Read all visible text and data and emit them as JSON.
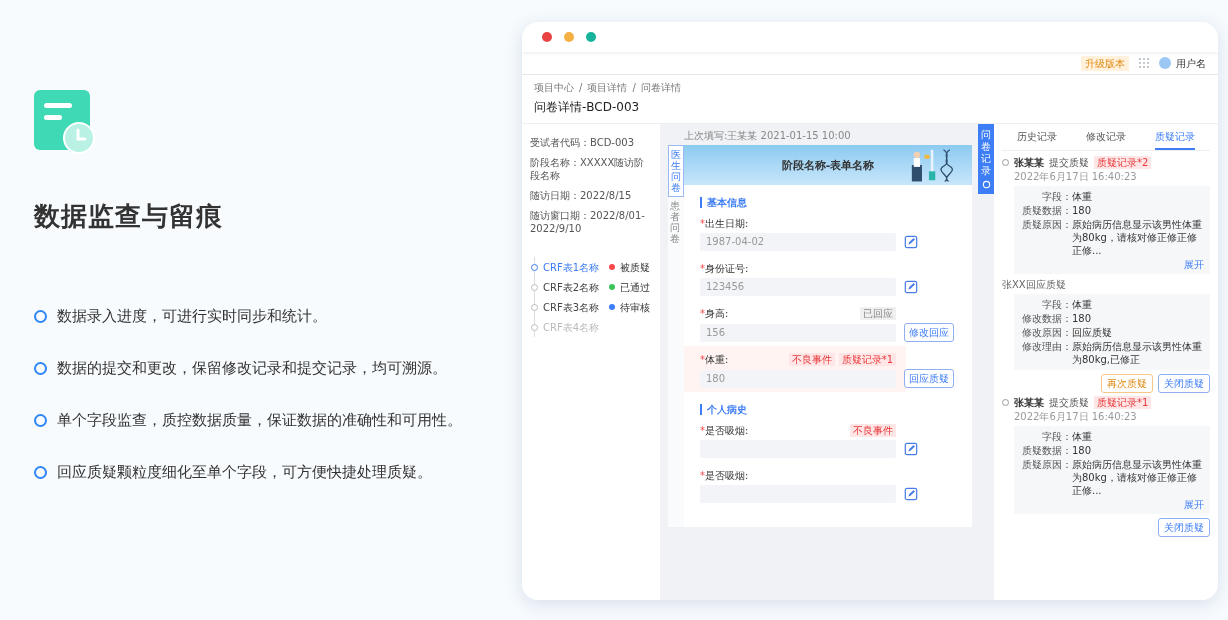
{
  "hero": {
    "title": "数据监查与留痕",
    "features": [
      "数据录入进度，可进行实时同步和统计。",
      "数据的提交和更改，保留修改记录和提交记录，均可溯源。",
      "单个字段监查，质控数据质量，保证数据的准确性和可用性。",
      "回应质疑颗粒度细化至单个字段，可方便快捷处理质疑。"
    ]
  },
  "app": {
    "topbar": {
      "badge": "升级版本",
      "user": "用户名"
    },
    "breadcrumb": {
      "items": [
        "项目中心",
        "项目详情",
        "问卷详情"
      ],
      "separator": "/"
    },
    "page_title": "问卷详情-BCD-003",
    "info": [
      "受试者代码：BCD-003",
      "阶段名称：XXXXX随访阶段名称",
      "随访日期：2022/8/15",
      "随访窗口期：2022/8/01-2022/9/10"
    ],
    "crf_forms": [
      {
        "name": "CRF表1名称",
        "selected": true,
        "disabled": false,
        "status": "被质疑",
        "color": "#f5484a"
      },
      {
        "name": "CRF表2名称",
        "selected": false,
        "disabled": false,
        "status": "已通过",
        "color": "#3cc45a"
      },
      {
        "name": "CRF表3名称",
        "selected": false,
        "disabled": false,
        "status": "待审核",
        "color": "#3d7df5"
      },
      {
        "name": "CRF表4名称",
        "selected": false,
        "disabled": true
      }
    ],
    "form": {
      "last_edit": "上次填写:王某某 2021-01-15 10:00",
      "side_tabs": [
        {
          "label": "医生问卷",
          "selected": true
        },
        {
          "label": "患者问卷",
          "selected": false
        }
      ],
      "banner_title": "阶段名称-表单名称",
      "sections": [
        {
          "title": "基本信息",
          "fields": [
            {
              "required_mark": "*",
              "label": "出生日期:",
              "value": "1987-04-02",
              "flagged": false,
              "action": {
                "kind": "edit"
              }
            },
            {
              "required_mark": "*",
              "label": "身份证号:",
              "value": "123456",
              "flagged": false,
              "action": {
                "kind": "edit"
              }
            },
            {
              "required_mark": "*",
              "label": "身高:",
              "value": "156",
              "flagged": false,
              "tags": [
                {
                  "text": "已回应",
                  "kind": "neutral"
                }
              ],
              "action": {
                "kind": "button",
                "label": "修改回应"
              }
            },
            {
              "required_mark": "*",
              "label": "体重:",
              "value": "180",
              "flagged": true,
              "tags": [
                {
                  "text": "不良事件",
                  "kind": "danger"
                },
                {
                  "text": "质疑记录*1",
                  "kind": "danger"
                }
              ],
              "action": {
                "kind": "button",
                "label": "回应质疑"
              }
            }
          ]
        },
        {
          "title": "个人病史",
          "fields": [
            {
              "required_mark": "*",
              "label": "是否吸烟:",
              "flagged": false,
              "tags": [
                {
                  "text": "不良事件",
                  "kind": "danger"
                }
              ],
              "action": {
                "kind": "edit"
              }
            },
            {
              "required_mark": "*",
              "label": "是否吸烟:",
              "flagged": false,
              "action": {
                "kind": "edit"
              }
            }
          ]
        }
      ]
    },
    "record_tab": "问卷记录",
    "records": {
      "tabs": [
        {
          "label": "历史记录",
          "selected": false
        },
        {
          "label": "修改记录",
          "selected": false
        },
        {
          "label": "质疑记录",
          "selected": true
        }
      ],
      "entries": [
        {
          "kind": "query",
          "user": "张某某",
          "action": "提交质疑",
          "tag": "质疑记录*2",
          "time": "2022年6月17日  16:40:23",
          "details": [
            {
              "label": "字段：",
              "value": "体重"
            },
            {
              "label": "质疑数据：",
              "value": "180"
            },
            {
              "label": "质疑原因：",
              "value": "原始病历信息显示该男性体重为80kg，请核对修正修正修正修...",
              "more": "展开"
            }
          ]
        },
        {
          "kind": "response",
          "title": "张XX回应质疑",
          "details": [
            {
              "label": "字段：",
              "value": "体重"
            },
            {
              "label": "修改数据：",
              "value": "180"
            },
            {
              "label": "修改原因：",
              "value": "回应质疑"
            },
            {
              "label": "修改理由：",
              "value": "原始病历信息显示该男性体重为80kg,已修正"
            }
          ],
          "buttons": [
            {
              "label": "再次质疑",
              "kind": "warning"
            },
            {
              "label": "关闭质疑",
              "kind": "primary"
            }
          ]
        },
        {
          "kind": "query",
          "user": "张某某",
          "action": "提交质疑",
          "tag": "质疑记录*1",
          "time": "2022年6月17日  16:40:23",
          "details": [
            {
              "label": "字段：",
              "value": "体重"
            },
            {
              "label": "质疑数据：",
              "value": "180"
            },
            {
              "label": "质疑原因：",
              "value": "原始病历信息显示该男性体重为80kg，请核对修正修正修正修...",
              "more": "展开"
            }
          ],
          "buttons": [
            {
              "label": "关闭质疑",
              "kind": "primary"
            }
          ]
        }
      ]
    }
  }
}
